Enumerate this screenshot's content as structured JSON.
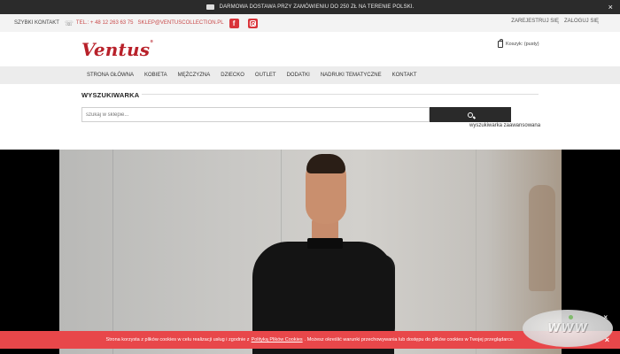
{
  "topbar": {
    "promo_text": "DARMOWA DOSTAWA PRZY ZAMÓWIENIU DO 250 ZŁ NA TERENIE POLSKI.",
    "close_label": "×"
  },
  "contactbar": {
    "quick_contact": "SZYBKI KONTAKT",
    "phone": "TEL.: + 48 12 263 63 75",
    "email": "SKLEP@VENTUSCOLLECTION.PL",
    "facebook_letter": "f",
    "register": "ZAREJESTRUJ SIĘ",
    "login": "ZALOGUJ SIĘ"
  },
  "header": {
    "logo_text": "Ventus",
    "logo_mark": "®",
    "cart_label": "Koszyk: (pusty)"
  },
  "nav": {
    "items": [
      {
        "label": "STRONA GŁÓWNA"
      },
      {
        "label": "KOBIETA"
      },
      {
        "label": "MĘŻCZYZNA"
      },
      {
        "label": "DZIECKO"
      },
      {
        "label": "OUTLET"
      },
      {
        "label": "DODATKI"
      },
      {
        "label": "NADRUKI TEMATYCZNE"
      },
      {
        "label": "KONTAKT"
      }
    ]
  },
  "search": {
    "title": "WYSZUKIWARKA",
    "placeholder": "szukaj w sklepie...",
    "advanced": "wyszukiwarka zaawansowana"
  },
  "cookie": {
    "text_before": "Strona korzysta z plików cookies w celu realizacji usług i zgodnie z",
    "link": "Polityką Plików Cookies",
    "text_after": ". Możesz określić warunki przechowywania lub dostępu do plików cookies w Twojej przeglądarce.",
    "close": "×"
  },
  "badge": {
    "text": "WWW",
    "close": "×"
  },
  "colors": {
    "brand_red": "#b8212a",
    "cookie_bar": "#e8474a",
    "top_bar": "#2b2b2b",
    "search_button": "#2a2a2a"
  },
  "icons": [
    "truck-icon",
    "phone-icon",
    "facebook-icon",
    "instagram-icon",
    "cart-icon",
    "search-icon",
    "close-icon"
  ]
}
